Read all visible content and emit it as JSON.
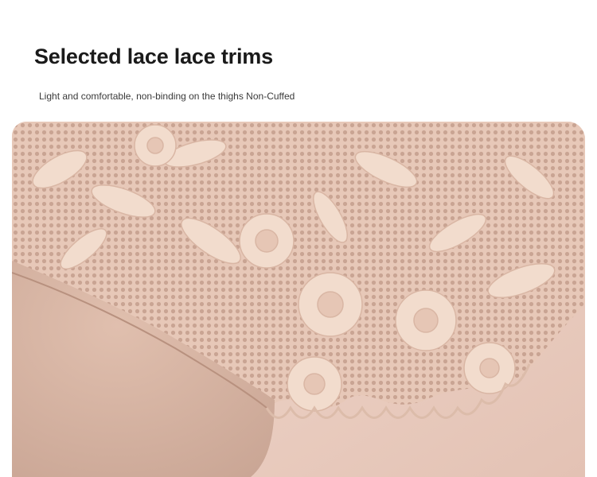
{
  "header": {
    "title": "Selected lace lace trims",
    "subtitle": "Light and comfortable, non-binding on the thighs Non-Cuffed"
  },
  "photo": {
    "subject": "lace-trim-closeup",
    "colors": {
      "lace": "#f0d8c9",
      "lace_shadow": "#e2bfae",
      "fabric": "#d7b4a3",
      "skin": "#e9cbbf",
      "mesh_gap": "#caa797"
    }
  }
}
